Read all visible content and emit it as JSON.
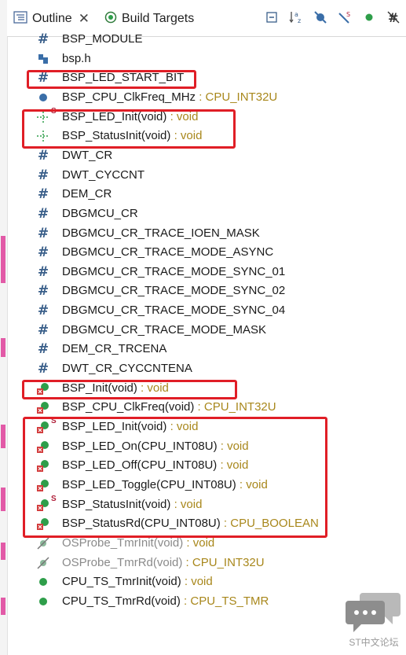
{
  "tabs": {
    "outline_label": "Outline",
    "build_label": "Build Targets"
  },
  "toolbar": {
    "icons": [
      "collapse-all-icon",
      "sort-alpha-icon",
      "hide-fields-icon",
      "hide-static-icon",
      "hide-nonpublic-icon",
      "hide-macros-icon"
    ]
  },
  "outline": {
    "items": [
      {
        "icon": "macro-hash-icon",
        "name": "BSP_MODULE",
        "type": ""
      },
      {
        "icon": "include-icon",
        "name": "bsp.h",
        "type": ""
      },
      {
        "icon": "macro-hash-icon",
        "name": "BSP_LED_START_BIT",
        "type": ""
      },
      {
        "icon": "variable-icon",
        "name": "BSP_CPU_ClkFreq_MHz",
        "type": " : CPU_INT32U"
      },
      {
        "icon": "function-decl-icon",
        "name": "BSP_LED_Init(void)",
        "type": " : void",
        "static": "S"
      },
      {
        "icon": "function-decl-icon",
        "name": "BSP_StatusInit(void)",
        "type": " : void"
      },
      {
        "icon": "macro-hash-icon",
        "name": "DWT_CR",
        "type": ""
      },
      {
        "icon": "macro-hash-icon",
        "name": "DWT_CYCCNT",
        "type": ""
      },
      {
        "icon": "macro-hash-icon",
        "name": "DEM_CR",
        "type": ""
      },
      {
        "icon": "macro-hash-icon",
        "name": "DBGMCU_CR",
        "type": ""
      },
      {
        "icon": "macro-hash-icon",
        "name": "DBGMCU_CR_TRACE_IOEN_MASK",
        "type": ""
      },
      {
        "icon": "macro-hash-icon",
        "name": "DBGMCU_CR_TRACE_MODE_ASYNC",
        "type": ""
      },
      {
        "icon": "macro-hash-icon",
        "name": "DBGMCU_CR_TRACE_MODE_SYNC_01",
        "type": ""
      },
      {
        "icon": "macro-hash-icon",
        "name": "DBGMCU_CR_TRACE_MODE_SYNC_02",
        "type": ""
      },
      {
        "icon": "macro-hash-icon",
        "name": "DBGMCU_CR_TRACE_MODE_SYNC_04",
        "type": ""
      },
      {
        "icon": "macro-hash-icon",
        "name": "DBGMCU_CR_TRACE_MODE_MASK",
        "type": ""
      },
      {
        "icon": "macro-hash-icon",
        "name": "DEM_CR_TRCENA",
        "type": ""
      },
      {
        "icon": "macro-hash-icon",
        "name": "DWT_CR_CYCCNTENA",
        "type": ""
      },
      {
        "icon": "function-error-icon",
        "name": "BSP_Init(void)",
        "type": " : void"
      },
      {
        "icon": "function-error-icon",
        "name": "BSP_CPU_ClkFreq(void)",
        "type": " : CPU_INT32U"
      },
      {
        "icon": "function-error-icon",
        "name": "BSP_LED_Init(void)",
        "type": " : void",
        "static": "S"
      },
      {
        "icon": "function-error-icon",
        "name": "BSP_LED_On(CPU_INT08U)",
        "type": " : void"
      },
      {
        "icon": "function-error-icon",
        "name": "BSP_LED_Off(CPU_INT08U)",
        "type": " : void"
      },
      {
        "icon": "function-error-icon",
        "name": "BSP_LED_Toggle(CPU_INT08U)",
        "type": " : void"
      },
      {
        "icon": "function-error-icon",
        "name": "BSP_StatusInit(void)",
        "type": " : void",
        "static": "S"
      },
      {
        "icon": "function-error-icon",
        "name": "BSP_StatusRd(CPU_INT08U)",
        "type": " : CPU_BOOLEAN"
      },
      {
        "icon": "function-disabled-icon",
        "name": "OSProbe_TmrInit(void)",
        "type": " : void",
        "dim": true
      },
      {
        "icon": "function-disabled-icon",
        "name": "OSProbe_TmrRd(void)",
        "type": " : CPU_INT32U",
        "dim": true
      },
      {
        "icon": "function-icon",
        "name": "CPU_TS_TmrInit(void)",
        "type": " : void"
      },
      {
        "icon": "function-icon",
        "name": "CPU_TS_TmrRd(void)",
        "type": " : CPU_TS_TMR"
      }
    ]
  },
  "colors": {
    "highlight": "#e01e26",
    "type_text": "#a8871b",
    "function_green": "#2e9e4a"
  },
  "watermark": {
    "text": "ST中文论坛"
  }
}
